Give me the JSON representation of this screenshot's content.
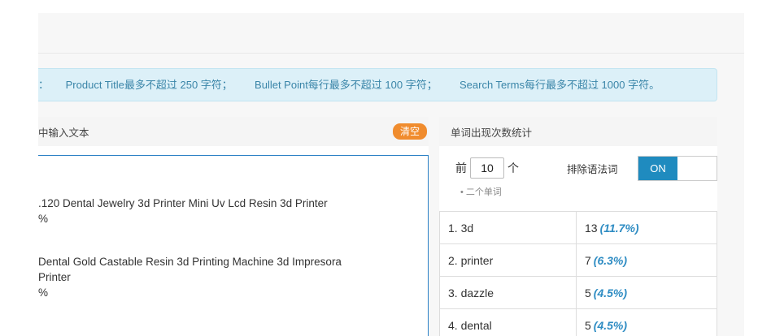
{
  "notice": {
    "lead": "：",
    "rules": [
      "Product Title最多不超过 250 字符；",
      "Bullet Point每行最多不超过 100 字符；",
      "Search Terms每行最多不超过 1000 字符。"
    ]
  },
  "input_panel": {
    "title": "中输入文本",
    "clear_label": "清空",
    "lines": [
      ".120 Dental Jewelry 3d Printer Mini Uv Lcd Resin 3d Printer",
      "%",
      "",
      "Dental Gold Castable Resin 3d Printing Machine 3d Impresora",
      "Printer",
      "%"
    ]
  },
  "stats_panel": {
    "title": "单词出现次数统计",
    "top_prefix": "前",
    "top_value": "10",
    "top_suffix": "个",
    "hint": "• 二个单词",
    "exclude_label": "排除语法词",
    "toggle_state": "ON",
    "rows": [
      {
        "word": "1. 3d",
        "count": "13",
        "pct": "(11.7%)"
      },
      {
        "word": "2. printer",
        "count": "7",
        "pct": "(6.3%)"
      },
      {
        "word": "3. dazzle",
        "count": "5",
        "pct": "(4.5%)"
      },
      {
        "word": "4. dental",
        "count": "5",
        "pct": "(4.5%)"
      }
    ]
  },
  "colors": {
    "accent_blue": "#1f8bbf",
    "clear_orange": "#f08c2e",
    "notice_bg": "#dcf0f8",
    "pct_blue": "#2e8cc3"
  }
}
